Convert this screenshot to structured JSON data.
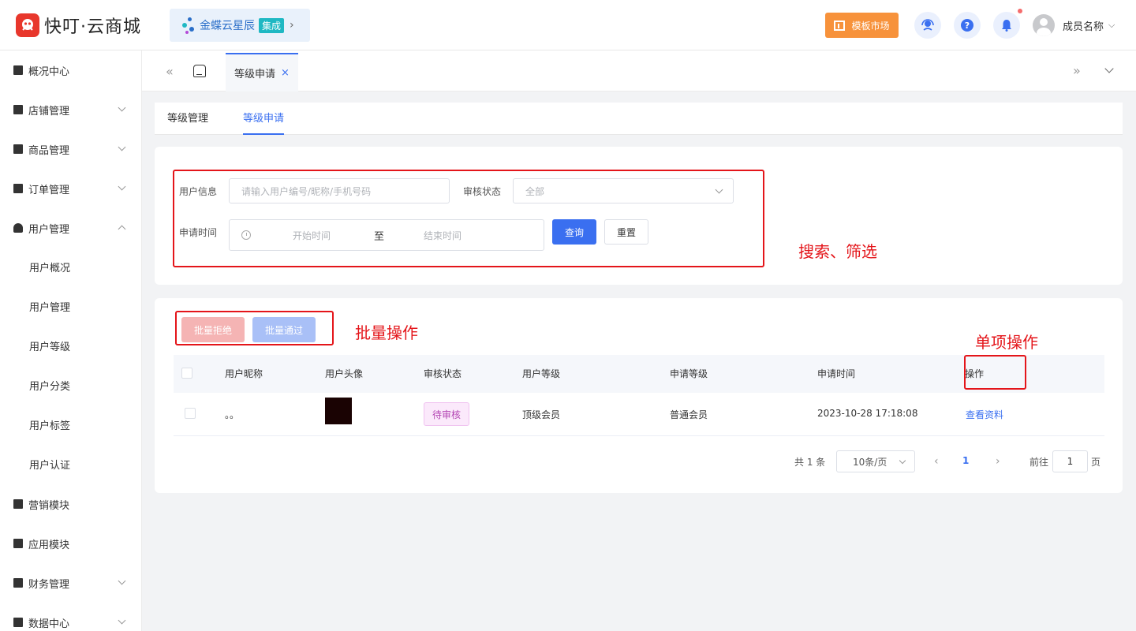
{
  "header": {
    "logo_text": "快叮·云商城",
    "integration": {
      "name": "金蝶云星辰",
      "badge": "集成",
      "chevron": "›"
    },
    "market_button": "模板市场",
    "help_icon_glyph": "?",
    "user_name": "成员名称",
    "user_chevron": "⌵"
  },
  "sidebar": {
    "items": [
      {
        "label": "概况中心",
        "icon": "bag-icon"
      },
      {
        "label": "店铺管理",
        "icon": "store-icon"
      },
      {
        "label": "商品管理",
        "icon": "briefcase-icon"
      },
      {
        "label": "订单管理",
        "icon": "clipboard-icon"
      },
      {
        "label": "用户管理",
        "icon": "user-icon"
      },
      {
        "label": "营销模块",
        "icon": "chart-icon"
      },
      {
        "label": "应用模块",
        "icon": "grid-icon"
      },
      {
        "label": "财务管理",
        "icon": "wallet-icon"
      },
      {
        "label": "数据中心",
        "icon": "bar-chart-icon"
      }
    ],
    "sub_items": [
      "用户概况",
      "用户管理",
      "用户等级",
      "用户分类",
      "用户标签",
      "用户认证"
    ]
  },
  "tabsbar": {
    "left_arrows": "«",
    "right_arrows": "»",
    "active_tab": "等级申请",
    "close": "×"
  },
  "subtabs": [
    "等级管理",
    "等级申请"
  ],
  "search": {
    "user_info_label": "用户信息",
    "user_info_placeholder": "请输入用户编号/昵称/手机号码",
    "status_label": "审核状态",
    "status_value": "全部",
    "time_label": "申请时间",
    "start_placeholder": "开始时间",
    "range_sep": "至",
    "end_placeholder": "结束时间",
    "query_button": "查询",
    "reset_button": "重置"
  },
  "batch": {
    "reject": "批量拒绝",
    "pass": "批量通过"
  },
  "annotations": {
    "search": "搜索、筛选",
    "batch": "批量操作",
    "single": "单项操作"
  },
  "table": {
    "columns": [
      "用户昵称",
      "用户头像",
      "审核状态",
      "用户等级",
      "申请等级",
      "申请时间",
      "操作"
    ],
    "rows": [
      {
        "nickname": "。。",
        "status": "待审核",
        "level": "顶级会员",
        "apply_level": "普通会员",
        "time": "2023-10-28 17:18:08",
        "action": "查看资料"
      }
    ]
  },
  "pagination": {
    "total": "共 1 条",
    "page_size": "10条/页",
    "prev": "‹",
    "next": "›",
    "current": "1",
    "goto_label": "前往",
    "goto_value": "1",
    "page_suffix": "页"
  },
  "colors": {
    "primary": "#3a6ff0",
    "annotation": "#e4151a",
    "logo": "#e8372c",
    "market": "#f7923b"
  }
}
